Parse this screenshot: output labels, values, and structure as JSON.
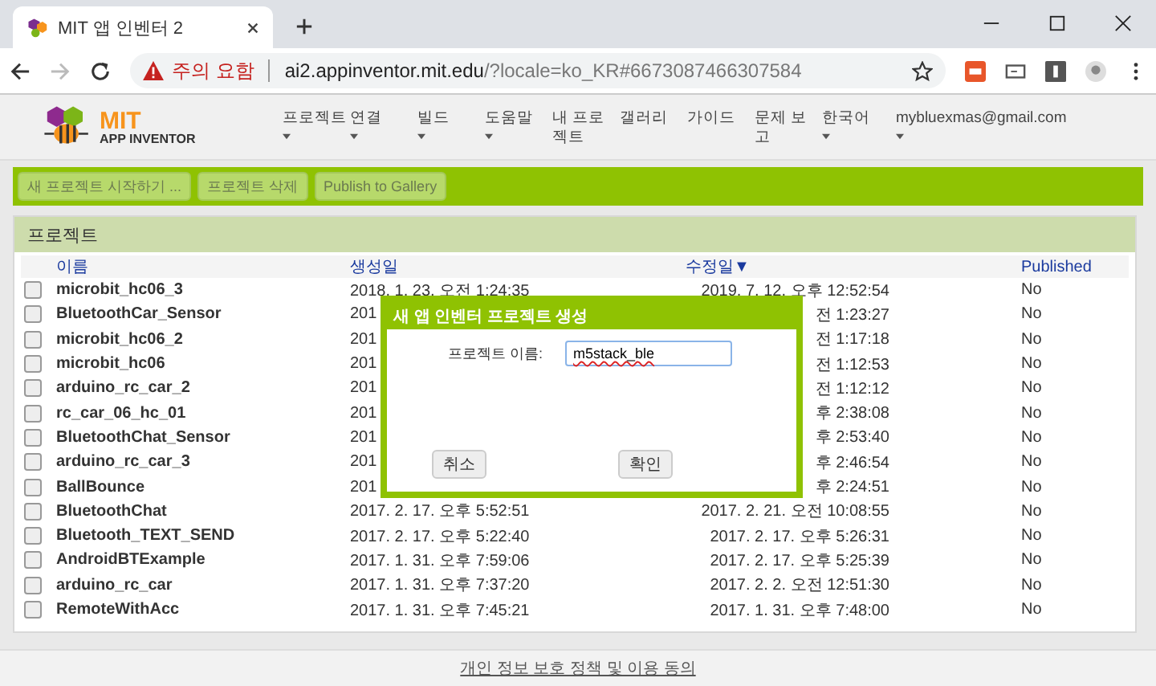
{
  "browser": {
    "tab_title": "MIT 앱 인벤터 2",
    "security_label": "주의 요함",
    "url_host": "ai2.appinventor.mit.edu",
    "url_rest": "/?locale=ko_KR#6673087466307584"
  },
  "app_header": {
    "logo_title": "MIT",
    "logo_subtitle": "APP INVENTOR",
    "nav": [
      {
        "label": "프로젝트",
        "dropdown": true
      },
      {
        "label": "연결",
        "dropdown": true
      },
      {
        "label": "빌드",
        "dropdown": true
      },
      {
        "label": "도움말",
        "dropdown": true
      },
      {
        "label": "내 프로젝트",
        "dropdown": false
      },
      {
        "label": "갤러리",
        "dropdown": false
      },
      {
        "label": "가이드",
        "dropdown": false
      },
      {
        "label": "문제 보고",
        "dropdown": false
      },
      {
        "label": "한국어",
        "dropdown": true
      },
      {
        "label": "mybluexmas@gmail.com",
        "dropdown": true
      }
    ]
  },
  "toolbar": {
    "buttons": [
      "새 프로젝트 시작하기 ...",
      "프로젝트 삭제",
      "Publish to Gallery"
    ]
  },
  "projects": {
    "title": "프로젝트",
    "columns": [
      "이름",
      "생성일",
      "수정일▼",
      "Published"
    ],
    "rows": [
      {
        "checked": false,
        "name": "microbit_hc06_3",
        "created": "2018. 1. 23. 오전 1:24:35",
        "modified": "2019. 7. 12. 오후 12:52:54",
        "published": "No"
      },
      {
        "checked": false,
        "name": "BluetoothCar_Sensor",
        "created": "201",
        "modified": "전 1:23:27",
        "published": "No"
      },
      {
        "checked": false,
        "name": "microbit_hc06_2",
        "created": "201",
        "modified": "전 1:17:18",
        "published": "No"
      },
      {
        "checked": false,
        "name": "microbit_hc06",
        "created": "201",
        "modified": "전 1:12:53",
        "published": "No"
      },
      {
        "checked": false,
        "name": "arduino_rc_car_2",
        "created": "201",
        "modified": "전 1:12:12",
        "published": "No"
      },
      {
        "checked": false,
        "name": "rc_car_06_hc_01",
        "created": "201",
        "modified": "후 2:38:08",
        "published": "No"
      },
      {
        "checked": false,
        "name": "BluetoothChat_Sensor",
        "created": "201",
        "modified": "후 2:53:40",
        "published": "No"
      },
      {
        "checked": false,
        "name": "arduino_rc_car_3",
        "created": "201",
        "modified": "후 2:46:54",
        "published": "No"
      },
      {
        "checked": false,
        "name": "BallBounce",
        "created": "201",
        "modified": "후 2:24:51",
        "published": "No"
      },
      {
        "checked": false,
        "name": "BluetoothChat",
        "created": "2017. 2. 17. 오후 5:52:51",
        "modified": "2017. 2. 21. 오전 10:08:55",
        "published": "No"
      },
      {
        "checked": false,
        "name": "Bluetooth_TEXT_SEND",
        "created": "2017. 2. 17. 오후 5:22:40",
        "modified": "2017. 2. 17. 오후 5:26:31",
        "published": "No"
      },
      {
        "checked": false,
        "name": "AndroidBTExample",
        "created": "2017. 1. 31. 오후 7:59:06",
        "modified": "2017. 2. 17. 오후 5:25:39",
        "published": "No"
      },
      {
        "checked": false,
        "name": "arduino_rc_car",
        "created": "2017. 1. 31. 오후 7:37:20",
        "modified": "2017. 2. 2. 오전 12:51:30",
        "published": "No"
      },
      {
        "checked": false,
        "name": "RemoteWithAcc",
        "created": "2017. 1. 31. 오후 7:45:21",
        "modified": "2017. 1. 31. 오후 7:48:00",
        "published": "No"
      }
    ]
  },
  "dialog": {
    "title": "새 앱 인벤터 프로젝트 생성",
    "field_label": "프로젝트 이름:",
    "field_value": "m5stack_ble",
    "buttons": [
      "취소",
      "확인"
    ]
  },
  "footer": {
    "link": "개인 정보 보호 정책 및 이용 동의"
  }
}
